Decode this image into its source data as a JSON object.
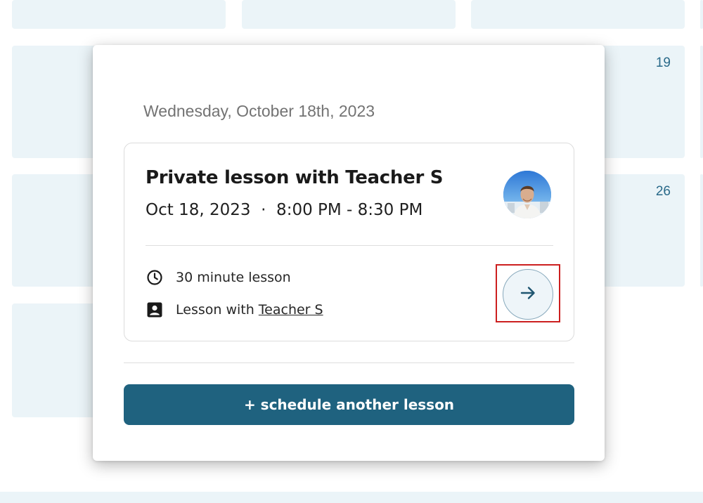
{
  "calendar": {
    "day_numbers": [
      "19",
      "26"
    ]
  },
  "modal": {
    "date_heading": "Wednesday, October 18th, 2023",
    "lesson": {
      "title": "Private lesson with Teacher S",
      "time": "Oct 18, 2023  ·  8:00 PM - 8:30 PM",
      "duration_text": "30 minute lesson",
      "teacher_prefix": "Lesson with ",
      "teacher_name": "Teacher S",
      "icons": {
        "duration": "clock-icon",
        "teacher": "person-badge-icon",
        "go": "arrow-right-icon"
      }
    },
    "schedule_button_label": "+ schedule another lesson"
  },
  "colors": {
    "accent": "#1f627f",
    "calendar_cell": "#ebf4f8",
    "highlight_border": "#cc1f1f"
  }
}
